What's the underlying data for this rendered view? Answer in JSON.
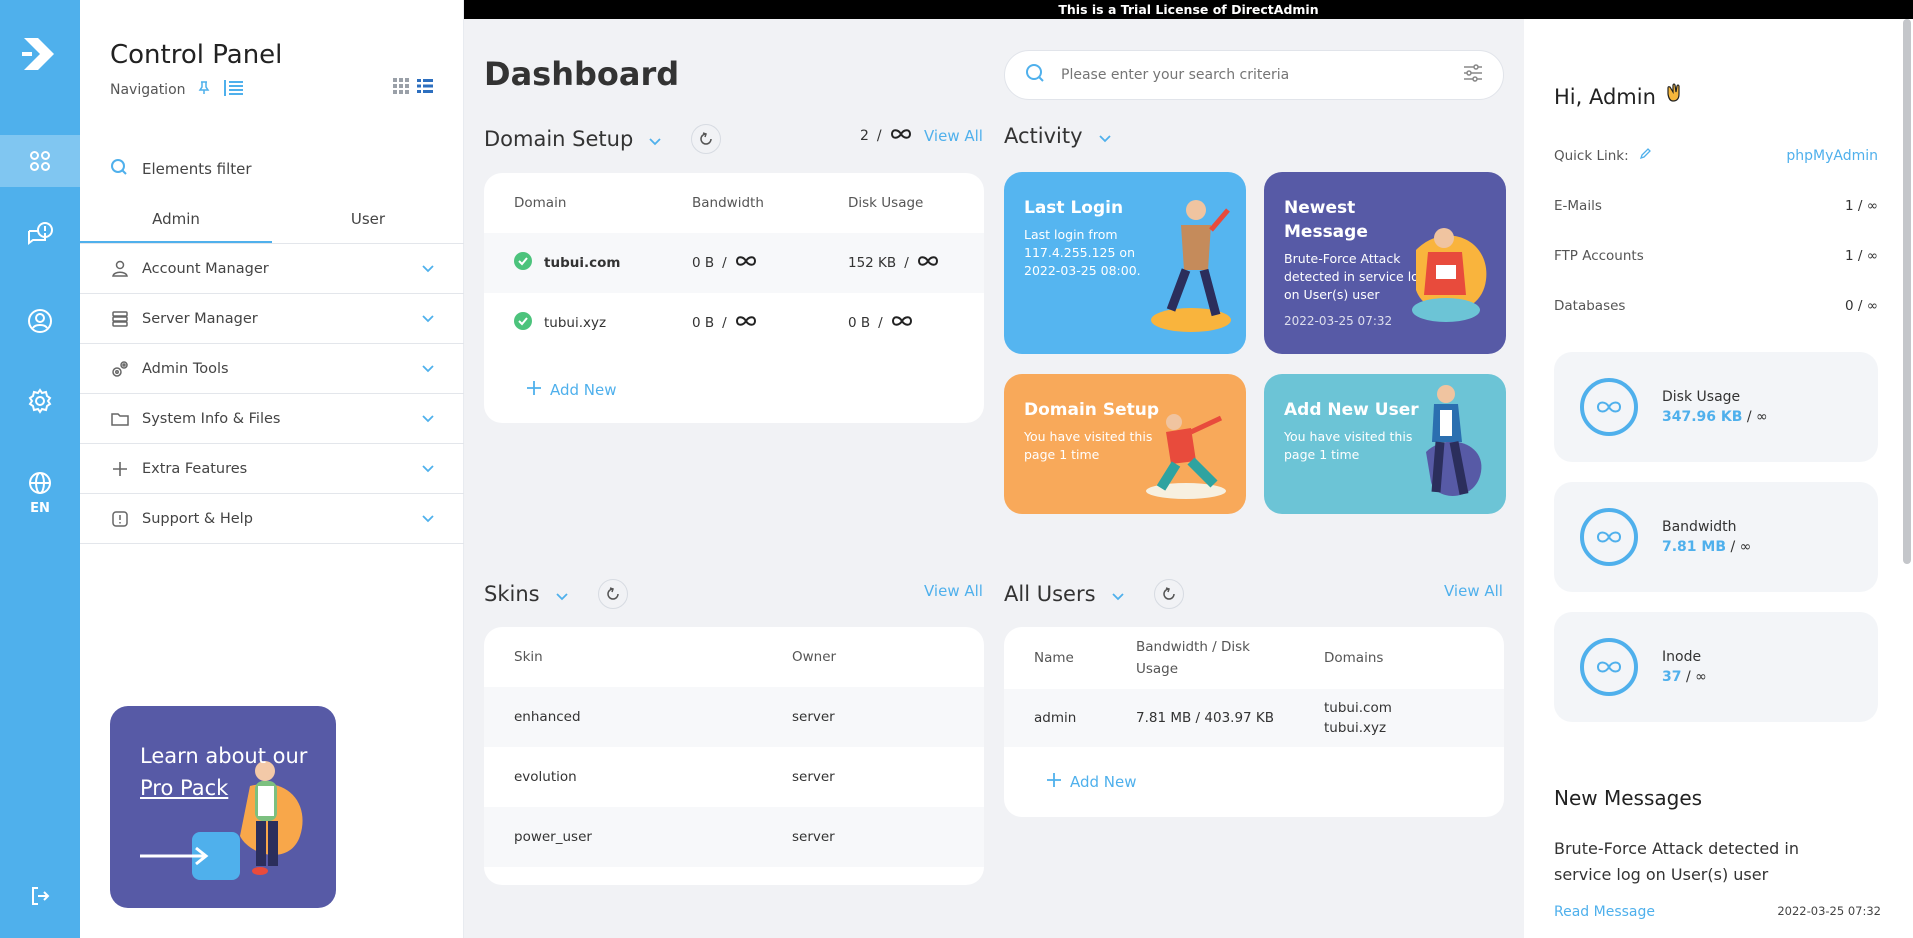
{
  "banner": "This is a Trial License of DirectAdmin",
  "rail": {
    "lang": "EN",
    "icons": [
      "dashboard-icon",
      "messages-icon",
      "user-icon",
      "settings-icon",
      "language-icon",
      "logout-icon"
    ]
  },
  "nav": {
    "title": "Control Panel",
    "subtitle": "Navigation",
    "filter_placeholder": "Elements filter",
    "tabs": [
      {
        "label": "Admin"
      },
      {
        "label": "User"
      }
    ],
    "items": [
      {
        "label": "Account Manager",
        "icon": "user-icon"
      },
      {
        "label": "Server Manager",
        "icon": "server-icon"
      },
      {
        "label": "Admin Tools",
        "icon": "gears-icon"
      },
      {
        "label": "System Info & Files",
        "icon": "folder-icon"
      },
      {
        "label": "Extra Features",
        "icon": "plus-icon"
      },
      {
        "label": "Support & Help",
        "icon": "alert-icon"
      }
    ],
    "promo": {
      "line1": "Learn about our",
      "link": "Pro Pack"
    }
  },
  "main": {
    "title": "Dashboard",
    "search_placeholder": "Please enter your search criteria",
    "domain_setup": {
      "title": "Domain Setup",
      "count": "2",
      "sep": "/",
      "view_all": "View All",
      "headers": [
        "Domain",
        "Bandwidth",
        "Disk Usage"
      ],
      "rows": [
        {
          "domain": "tubui.com",
          "bandwidth": "0 B",
          "disk": "152 KB"
        },
        {
          "domain": "tubui.xyz",
          "bandwidth": "0 B",
          "disk": "0 B"
        }
      ],
      "add_new": "Add New"
    },
    "activity": {
      "title": "Activity",
      "cards": [
        {
          "title": "Last Login",
          "desc": "Last login from 117.4.255.125 on 2022-03-25 08:00.",
          "date": "",
          "color": "#55b5f0"
        },
        {
          "title": "Newest Message",
          "desc": "Brute-Force Attack detected in service log on User(s) user",
          "date": "2022-03-25 07:32",
          "color": "#575aa6"
        },
        {
          "title": "Domain Setup",
          "desc": "You have visited this page 1 time",
          "date": "",
          "color": "#f8a95a"
        },
        {
          "title": "Add New User",
          "desc": "You have visited this page 1 time",
          "date": "",
          "color": "#6cc4d6"
        }
      ]
    },
    "skins": {
      "title": "Skins",
      "view_all": "View All",
      "headers": [
        "Skin",
        "Owner"
      ],
      "rows": [
        {
          "skin": "enhanced",
          "owner": "server"
        },
        {
          "skin": "evolution",
          "owner": "server"
        },
        {
          "skin": "power_user",
          "owner": "server"
        }
      ]
    },
    "users": {
      "title": "All Users",
      "view_all": "View All",
      "headers": [
        "Name",
        "Bandwidth / Disk Usage",
        "Domains"
      ],
      "rows": [
        {
          "name": "admin",
          "usage": "7.81 MB / 403.97 KB",
          "domain1": "tubui.com",
          "domain2": "tubui.xyz"
        }
      ],
      "add_new": "Add New"
    }
  },
  "right": {
    "greeting": "Hi, Admin",
    "quick_link_label": "Quick Link:",
    "quick_link_value": "phpMyAdmin",
    "stats": [
      {
        "label": "E-Mails",
        "value": "1 / ∞"
      },
      {
        "label": "FTP Accounts",
        "value": "1 / ∞"
      },
      {
        "label": "Databases",
        "value": "0 / ∞"
      }
    ],
    "usage": [
      {
        "label": "Disk Usage",
        "value": "347.96 KB",
        "limit": "/ ∞"
      },
      {
        "label": "Bandwidth",
        "value": "7.81 MB",
        "limit": "/ ∞"
      },
      {
        "label": "Inode",
        "value": "37",
        "limit": "/ ∞"
      }
    ],
    "new_messages": {
      "title": "New Messages",
      "text": "Brute-Force Attack detected in service log on User(s) user",
      "read": "Read Message",
      "date": "2022-03-25 07:32"
    }
  },
  "colors": {
    "accent": "#4fb0ec",
    "rail": "#4fb0ec",
    "success": "#4cc37c"
  }
}
